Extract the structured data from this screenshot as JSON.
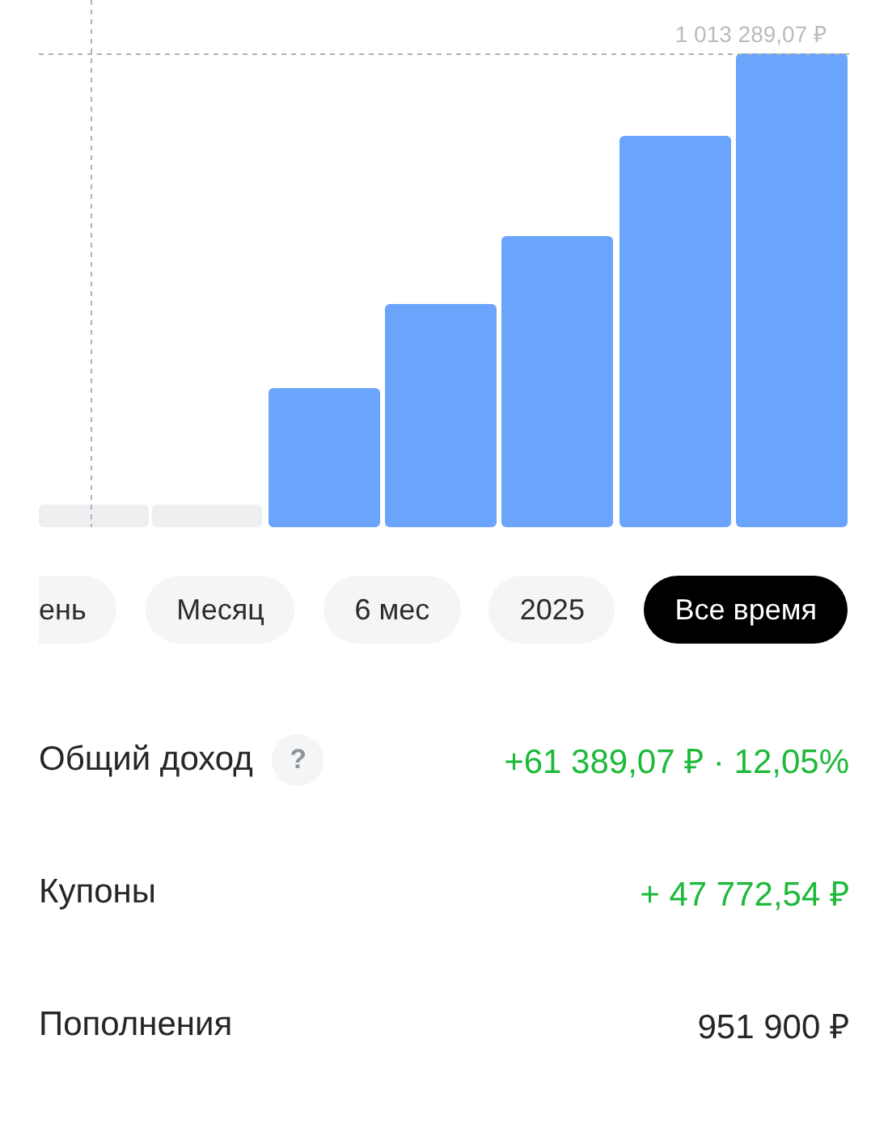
{
  "chart": {
    "max_label": "1 013 289,07 ₽"
  },
  "periods": [
    {
      "label": "ень",
      "selected": false
    },
    {
      "label": "Месяц",
      "selected": false
    },
    {
      "label": "6 мес",
      "selected": false
    },
    {
      "label": "2025",
      "selected": false
    },
    {
      "label": "Все время",
      "selected": true
    }
  ],
  "rows": [
    {
      "label": "Общий доход",
      "help": "?",
      "value": "+61 389,07 ₽ · 12,05%",
      "kind": "positive"
    },
    {
      "label": "Купоны",
      "value": "+ 47 772,54 ₽",
      "kind": "positive"
    },
    {
      "label": "Пополнения",
      "value": "951 900 ₽",
      "kind": "neutral"
    }
  ]
}
